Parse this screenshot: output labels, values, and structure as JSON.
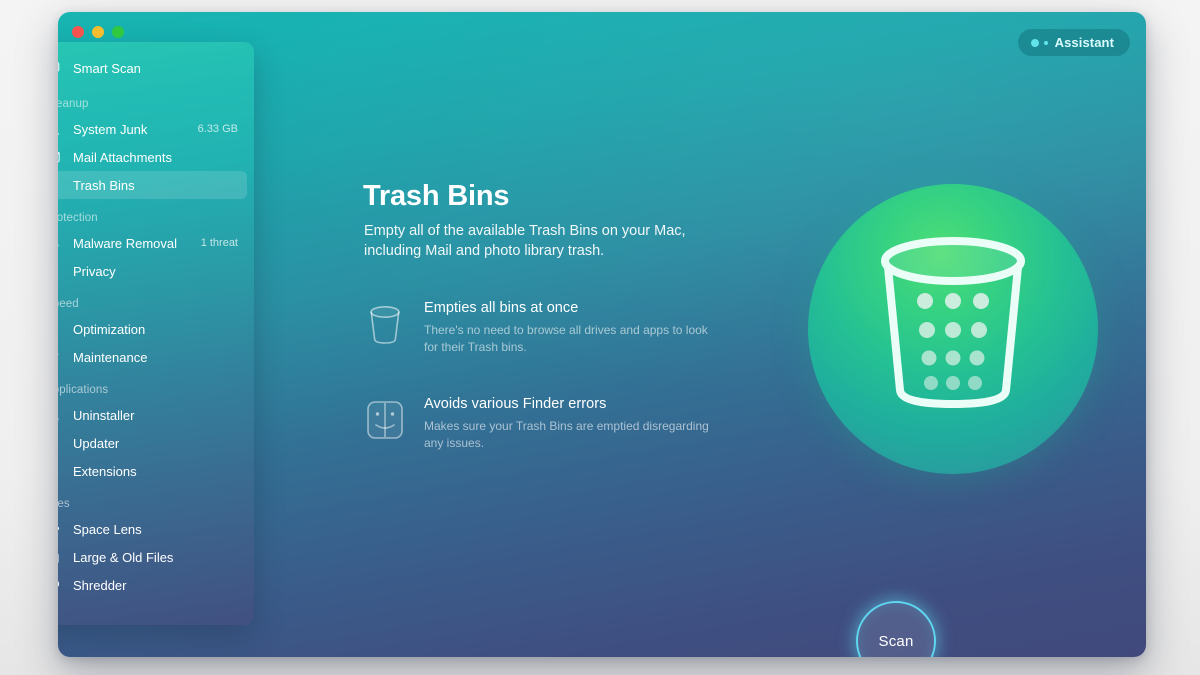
{
  "window": {
    "traffic_lights": [
      {
        "name": "close",
        "color": "#f7544f"
      },
      {
        "name": "minimize",
        "color": "#f8bd2e"
      },
      {
        "name": "zoom",
        "color": "#2fc840"
      }
    ],
    "assistant_label": "Assistant"
  },
  "sidebar": {
    "top_item": {
      "label": "Smart Scan",
      "icon": "monitor-icon"
    },
    "groups": [
      {
        "title": "Cleanup",
        "items": [
          {
            "label": "System Junk",
            "icon": "spray-icon",
            "badge": "6.33 GB",
            "selected": false
          },
          {
            "label": "Mail Attachments",
            "icon": "envelope-icon",
            "badge": "",
            "selected": false
          },
          {
            "label": "Trash Bins",
            "icon": "trash-icon",
            "badge": "",
            "selected": true
          }
        ]
      },
      {
        "title": "Protection",
        "items": [
          {
            "label": "Malware Removal",
            "icon": "biohazard-icon",
            "badge": "1 threat",
            "selected": false
          },
          {
            "label": "Privacy",
            "icon": "hand-icon",
            "badge": "",
            "selected": false
          }
        ]
      },
      {
        "title": "Speed",
        "items": [
          {
            "label": "Optimization",
            "icon": "sliders-icon",
            "badge": "",
            "selected": false
          },
          {
            "label": "Maintenance",
            "icon": "wrench-icon",
            "badge": "",
            "selected": false
          }
        ]
      },
      {
        "title": "Applications",
        "items": [
          {
            "label": "Uninstaller",
            "icon": "uninstall-icon",
            "badge": "",
            "selected": false
          },
          {
            "label": "Updater",
            "icon": "refresh-icon",
            "badge": "",
            "selected": false
          },
          {
            "label": "Extensions",
            "icon": "puzzle-icon",
            "badge": "",
            "selected": false
          }
        ]
      },
      {
        "title": "Files",
        "items": [
          {
            "label": "Space Lens",
            "icon": "lens-icon",
            "badge": "",
            "selected": false
          },
          {
            "label": "Large & Old Files",
            "icon": "folder-icon",
            "badge": "",
            "selected": false
          },
          {
            "label": "Shredder",
            "icon": "shredder-icon",
            "badge": "",
            "selected": false
          }
        ]
      }
    ]
  },
  "main": {
    "title": "Trash Bins",
    "subtitle": "Empty all of the available Trash Bins on your Mac, including Mail and photo library trash.",
    "features": [
      {
        "icon": "trash-outline-icon",
        "heading": "Empties all bins at once",
        "body": "There's no need to browse all drives and apps to look for their Trash bins."
      },
      {
        "icon": "finder-icon",
        "heading": "Avoids various Finder errors",
        "body": "Makes sure your Trash Bins are emptied disregarding any issues."
      }
    ],
    "hero_icon": "trash-bin-hero-icon",
    "scan_button": "Scan"
  },
  "colors": {
    "window_top": "#17b5b1",
    "window_bottom": "#41497c",
    "hero_green": "#4ede74",
    "hero_teal": "#35909c",
    "scan_ring": "#5ed7f0",
    "assistant_dot": "#62e3ea"
  }
}
